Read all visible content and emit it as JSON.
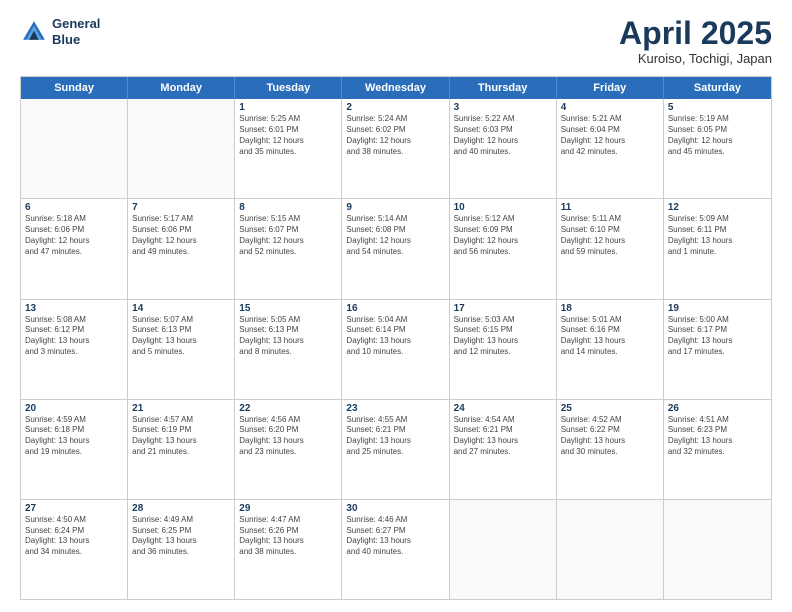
{
  "header": {
    "logo_line1": "General",
    "logo_line2": "Blue",
    "month_title": "April 2025",
    "location": "Kuroiso, Tochigi, Japan"
  },
  "weekdays": [
    "Sunday",
    "Monday",
    "Tuesday",
    "Wednesday",
    "Thursday",
    "Friday",
    "Saturday"
  ],
  "rows": [
    [
      {
        "day": "",
        "info": ""
      },
      {
        "day": "",
        "info": ""
      },
      {
        "day": "1",
        "info": "Sunrise: 5:25 AM\nSunset: 6:01 PM\nDaylight: 12 hours\nand 35 minutes."
      },
      {
        "day": "2",
        "info": "Sunrise: 5:24 AM\nSunset: 6:02 PM\nDaylight: 12 hours\nand 38 minutes."
      },
      {
        "day": "3",
        "info": "Sunrise: 5:22 AM\nSunset: 6:03 PM\nDaylight: 12 hours\nand 40 minutes."
      },
      {
        "day": "4",
        "info": "Sunrise: 5:21 AM\nSunset: 6:04 PM\nDaylight: 12 hours\nand 42 minutes."
      },
      {
        "day": "5",
        "info": "Sunrise: 5:19 AM\nSunset: 6:05 PM\nDaylight: 12 hours\nand 45 minutes."
      }
    ],
    [
      {
        "day": "6",
        "info": "Sunrise: 5:18 AM\nSunset: 6:06 PM\nDaylight: 12 hours\nand 47 minutes."
      },
      {
        "day": "7",
        "info": "Sunrise: 5:17 AM\nSunset: 6:06 PM\nDaylight: 12 hours\nand 49 minutes."
      },
      {
        "day": "8",
        "info": "Sunrise: 5:15 AM\nSunset: 6:07 PM\nDaylight: 12 hours\nand 52 minutes."
      },
      {
        "day": "9",
        "info": "Sunrise: 5:14 AM\nSunset: 6:08 PM\nDaylight: 12 hours\nand 54 minutes."
      },
      {
        "day": "10",
        "info": "Sunrise: 5:12 AM\nSunset: 6:09 PM\nDaylight: 12 hours\nand 56 minutes."
      },
      {
        "day": "11",
        "info": "Sunrise: 5:11 AM\nSunset: 6:10 PM\nDaylight: 12 hours\nand 59 minutes."
      },
      {
        "day": "12",
        "info": "Sunrise: 5:09 AM\nSunset: 6:11 PM\nDaylight: 13 hours\nand 1 minute."
      }
    ],
    [
      {
        "day": "13",
        "info": "Sunrise: 5:08 AM\nSunset: 6:12 PM\nDaylight: 13 hours\nand 3 minutes."
      },
      {
        "day": "14",
        "info": "Sunrise: 5:07 AM\nSunset: 6:13 PM\nDaylight: 13 hours\nand 5 minutes."
      },
      {
        "day": "15",
        "info": "Sunrise: 5:05 AM\nSunset: 6:13 PM\nDaylight: 13 hours\nand 8 minutes."
      },
      {
        "day": "16",
        "info": "Sunrise: 5:04 AM\nSunset: 6:14 PM\nDaylight: 13 hours\nand 10 minutes."
      },
      {
        "day": "17",
        "info": "Sunrise: 5:03 AM\nSunset: 6:15 PM\nDaylight: 13 hours\nand 12 minutes."
      },
      {
        "day": "18",
        "info": "Sunrise: 5:01 AM\nSunset: 6:16 PM\nDaylight: 13 hours\nand 14 minutes."
      },
      {
        "day": "19",
        "info": "Sunrise: 5:00 AM\nSunset: 6:17 PM\nDaylight: 13 hours\nand 17 minutes."
      }
    ],
    [
      {
        "day": "20",
        "info": "Sunrise: 4:59 AM\nSunset: 6:18 PM\nDaylight: 13 hours\nand 19 minutes."
      },
      {
        "day": "21",
        "info": "Sunrise: 4:57 AM\nSunset: 6:19 PM\nDaylight: 13 hours\nand 21 minutes."
      },
      {
        "day": "22",
        "info": "Sunrise: 4:56 AM\nSunset: 6:20 PM\nDaylight: 13 hours\nand 23 minutes."
      },
      {
        "day": "23",
        "info": "Sunrise: 4:55 AM\nSunset: 6:21 PM\nDaylight: 13 hours\nand 25 minutes."
      },
      {
        "day": "24",
        "info": "Sunrise: 4:54 AM\nSunset: 6:21 PM\nDaylight: 13 hours\nand 27 minutes."
      },
      {
        "day": "25",
        "info": "Sunrise: 4:52 AM\nSunset: 6:22 PM\nDaylight: 13 hours\nand 30 minutes."
      },
      {
        "day": "26",
        "info": "Sunrise: 4:51 AM\nSunset: 6:23 PM\nDaylight: 13 hours\nand 32 minutes."
      }
    ],
    [
      {
        "day": "27",
        "info": "Sunrise: 4:50 AM\nSunset: 6:24 PM\nDaylight: 13 hours\nand 34 minutes."
      },
      {
        "day": "28",
        "info": "Sunrise: 4:49 AM\nSunset: 6:25 PM\nDaylight: 13 hours\nand 36 minutes."
      },
      {
        "day": "29",
        "info": "Sunrise: 4:47 AM\nSunset: 6:26 PM\nDaylight: 13 hours\nand 38 minutes."
      },
      {
        "day": "30",
        "info": "Sunrise: 4:46 AM\nSunset: 6:27 PM\nDaylight: 13 hours\nand 40 minutes."
      },
      {
        "day": "",
        "info": ""
      },
      {
        "day": "",
        "info": ""
      },
      {
        "day": "",
        "info": ""
      }
    ]
  ]
}
